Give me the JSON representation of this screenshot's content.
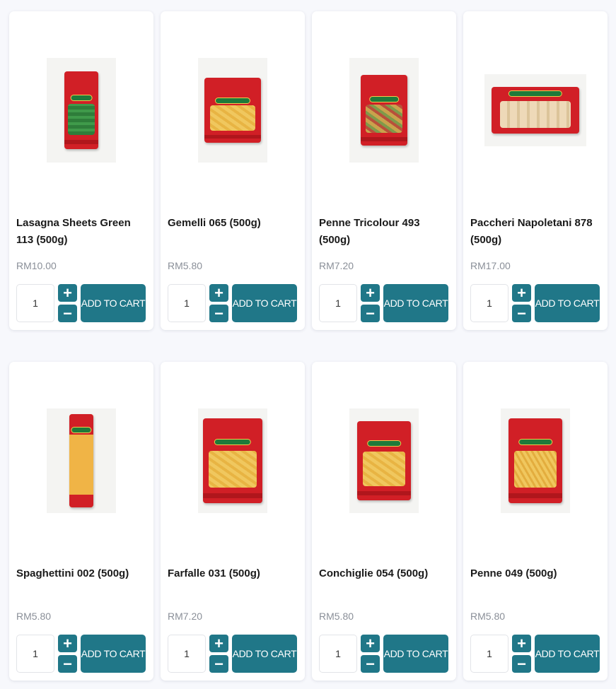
{
  "colors": {
    "accent": "#207788",
    "price": "#8a8f98",
    "pack_red": "#d11f26",
    "pasta_yellow": "#f0c75e"
  },
  "icons": {
    "increment": "plus-icon",
    "decrement": "minus-icon"
  },
  "products": [
    {
      "name": "Lasagna Sheets Green 113 (500g)",
      "price": "RM10.00",
      "qty": "1",
      "add_label": "ADD TO CART",
      "plus": "+",
      "minus": "−"
    },
    {
      "name": "Gemelli 065 (500g)",
      "price": "RM5.80",
      "qty": "1",
      "add_label": "ADD TO CART",
      "plus": "+",
      "minus": "−"
    },
    {
      "name": "Penne Tricolour 493 (500g)",
      "price": "RM7.20",
      "qty": "1",
      "add_label": "ADD TO CART",
      "plus": "+",
      "minus": "−"
    },
    {
      "name": "Paccheri Napoletani 878 (500g)",
      "price": "RM17.00",
      "qty": "1",
      "add_label": "ADD TO CART",
      "plus": "+",
      "minus": "−"
    },
    {
      "name": "Spaghettini 002 (500g)",
      "price": "RM5.80",
      "qty": "1",
      "add_label": "ADD TO CART",
      "plus": "+",
      "minus": "−"
    },
    {
      "name": "Farfalle 031 (500g)",
      "price": "RM7.20",
      "qty": "1",
      "add_label": "ADD TO CART",
      "plus": "+",
      "minus": "−"
    },
    {
      "name": "Conchiglie 054 (500g)",
      "price": "RM5.80",
      "qty": "1",
      "add_label": "ADD TO CART",
      "plus": "+",
      "minus": "−"
    },
    {
      "name": "Penne 049 (500g)",
      "price": "RM5.80",
      "qty": "1",
      "add_label": "ADD TO CART",
      "plus": "+",
      "minus": "−"
    }
  ]
}
